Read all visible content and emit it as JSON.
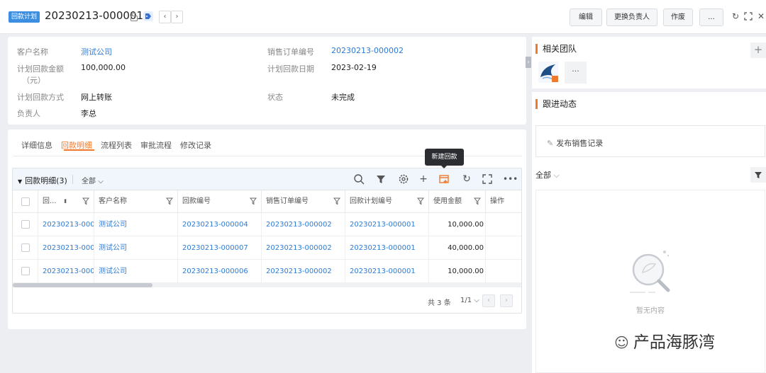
{
  "header": {
    "type_tag": "回款计划",
    "title": "20230213-000001",
    "prev": "‹",
    "next": "›",
    "edit_label": "编辑",
    "change_owner_label": "更换负责人",
    "void_label": "作废",
    "more_label": "..."
  },
  "info": {
    "customer_label": "客户名称",
    "customer_value": "测试公司",
    "amount_label_1": "计划回款金额",
    "amount_label_2": "（元）",
    "amount_value": "100,000.00",
    "method_label": "计划回款方式",
    "method_value": "网上转账",
    "owner_label": "负责人",
    "owner_value": "李总",
    "order_no_label": "销售订单编号",
    "order_no_value": "20230213-000002",
    "date_label": "计划回款日期",
    "date_value": "2023-02-19",
    "status_label": "状态",
    "status_value": "未完成"
  },
  "tabs": [
    "详细信息",
    "回款明细",
    "流程列表",
    "审批流程",
    "修改记录"
  ],
  "subtable": {
    "title": "回款明细(3)",
    "filter": "全部",
    "tooltip": "新建回款",
    "columns": [
      "回...",
      "客户名称",
      "回款编号",
      "销售订单编号",
      "回款计划编号",
      "使用金额",
      "操作"
    ],
    "rows": [
      [
        "20230213-000...",
        "测试公司",
        "20230213-000004",
        "20230213-000002",
        "20230213-000001",
        "10,000.00"
      ],
      [
        "20230213-000...",
        "测试公司",
        "20230213-000007",
        "20230213-000002",
        "20230213-000001",
        "40,000.00"
      ],
      [
        "20230213-000...",
        "测试公司",
        "20230213-000006",
        "20230213-000002",
        "20230213-000001",
        "10,000.00"
      ]
    ],
    "total": "共 3 条",
    "page": "1/1"
  },
  "team": {
    "title": "相关团队",
    "more": "···"
  },
  "follow": {
    "title": "跟进动态",
    "publish": "发布销售记录",
    "filter": "全部",
    "empty": "暂无内容"
  },
  "watermark": "产品海豚湾",
  "colors": {
    "accent": "#f07a2c",
    "link": "#2d7bd4",
    "tag": "#3b8ee0"
  }
}
